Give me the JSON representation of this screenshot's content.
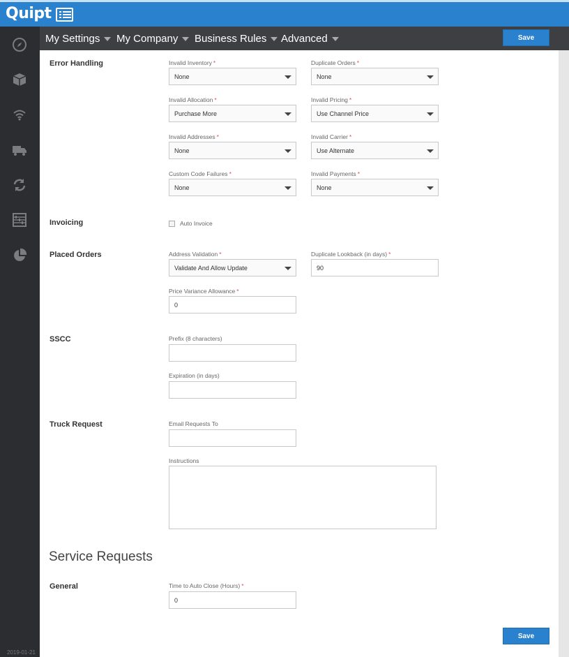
{
  "app": {
    "logo": "Quipt",
    "version_date": "2019-01-21"
  },
  "nav": {
    "items": [
      "My Settings",
      "My Company",
      "Business Rules",
      "Advanced"
    ],
    "save_label": "Save"
  },
  "sidebar": {
    "icons": [
      "compass-icon",
      "box-icon",
      "wifi-icon",
      "truck-icon",
      "sync-icon",
      "abacus-icon",
      "pie-chart-icon"
    ]
  },
  "error_handling": {
    "label": "Error Handling",
    "invalid_inventory": {
      "label": "Invalid Inventory",
      "value": "None"
    },
    "duplicate_orders": {
      "label": "Duplicate Orders",
      "value": "None"
    },
    "invalid_allocation": {
      "label": "Invalid Allocation",
      "value": "Purchase More"
    },
    "invalid_pricing": {
      "label": "Invalid Pricing",
      "value": "Use Channel Price"
    },
    "invalid_addresses": {
      "label": "Invalid Addresses",
      "value": "None"
    },
    "invalid_carrier": {
      "label": "Invalid Carrier",
      "value": "Use Alternate"
    },
    "custom_code_failures": {
      "label": "Custom Code Failures",
      "value": "None"
    },
    "invalid_payments": {
      "label": "Invalid Payments",
      "value": "None"
    }
  },
  "invoicing": {
    "label": "Invoicing",
    "auto_invoice_label": "Auto Invoice",
    "auto_invoice_checked": false
  },
  "placed_orders": {
    "label": "Placed Orders",
    "address_validation": {
      "label": "Address Validation",
      "value": "Validate And Allow Update"
    },
    "duplicate_lookback": {
      "label": "Duplicate Lookback (in days)",
      "value": "90"
    },
    "price_variance": {
      "label": "Price Variance Allowance",
      "value": "0"
    }
  },
  "sscc": {
    "label": "SSCC",
    "prefix": {
      "label": "Prefix (8 characters)",
      "value": ""
    },
    "expiration": {
      "label": "Expiration (in days)",
      "value": ""
    }
  },
  "truck_request": {
    "label": "Truck Request",
    "email": {
      "label": "Email Requests To",
      "value": ""
    },
    "instructions": {
      "label": "Instructions",
      "value": ""
    }
  },
  "service_requests": {
    "heading": "Service Requests",
    "general_label": "General",
    "auto_close": {
      "label": "Time to Auto Close (Hours)",
      "value": "0"
    }
  },
  "footer": {
    "save_label": "Save"
  },
  "colors": {
    "brand": "#2a82cf",
    "sidebar": "#2b2d31",
    "navbar": "#3d3f43",
    "required": "#d9534f"
  }
}
